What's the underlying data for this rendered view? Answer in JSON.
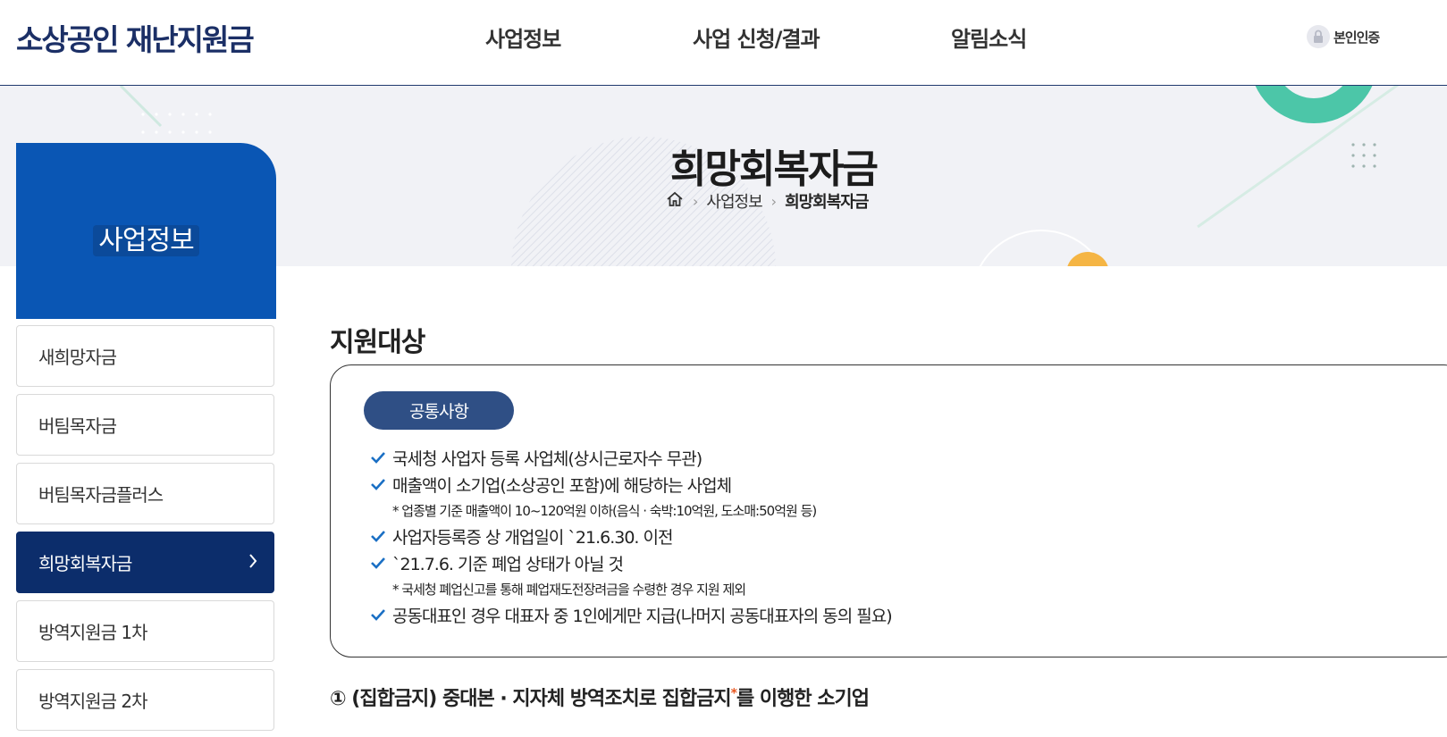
{
  "header": {
    "logo": "소상공인 재난지원금",
    "nav": [
      "사업정보",
      "사업 신청/결과",
      "알림소식"
    ],
    "verify_label": "본인인증"
  },
  "hero": {
    "title": "희망회복자금",
    "breadcrumb": {
      "level1": "사업정보",
      "current": "희망회복자금"
    }
  },
  "sidebar": {
    "title": "사업정보",
    "items": [
      {
        "label": "새희망자금"
      },
      {
        "label": "버팀목자금"
      },
      {
        "label": "버팀목자금플러스"
      },
      {
        "label": "희망회복자금",
        "active": true
      },
      {
        "label": "방역지원금 1차"
      },
      {
        "label": "방역지원금 2차"
      }
    ]
  },
  "content": {
    "section_title": "지원대상",
    "pill": "공통사항",
    "criteria": [
      {
        "text": "국세청 사업자 등록 사업체(상시근로자수 무관)"
      },
      {
        "text": "매출액이 소기업(소상공인 포함)에 해당하는 사업체",
        "note": "* 업종별 기준 매출액이 10~120억원 이하(음식 · 숙박:10억원, 도소매:50억원 등)"
      },
      {
        "text": "사업자등록증 상 개업일이 `21.6.30. 이전"
      },
      {
        "text": "`21.7.6. 기준 폐업 상태가 아닐 것",
        "note": "* 국세청 폐업신고를 통해 폐업재도전장려금을 수령한 경우 지원 제외"
      },
      {
        "text": "공동대표인 경우 대표자 중 1인에게만 지급(나머지 공동대표자의 동의 필요)"
      }
    ],
    "subsection": {
      "prefix": "① (집합금지) 중대본 · 지자체 방역조치로 집합금지",
      "asterisk": "*",
      "suffix": "를 이행한 소기업"
    }
  },
  "colors": {
    "brand_navy": "#1b2f66",
    "sidebar_blue": "#0a56b4",
    "active_navy": "#0c2d6b",
    "pill_blue": "#2f4f85",
    "check_blue": "#1a6fc4",
    "accent_teal": "#4cc6a8",
    "accent_orange": "#f5b544",
    "asterisk_orange": "#e8551e"
  }
}
